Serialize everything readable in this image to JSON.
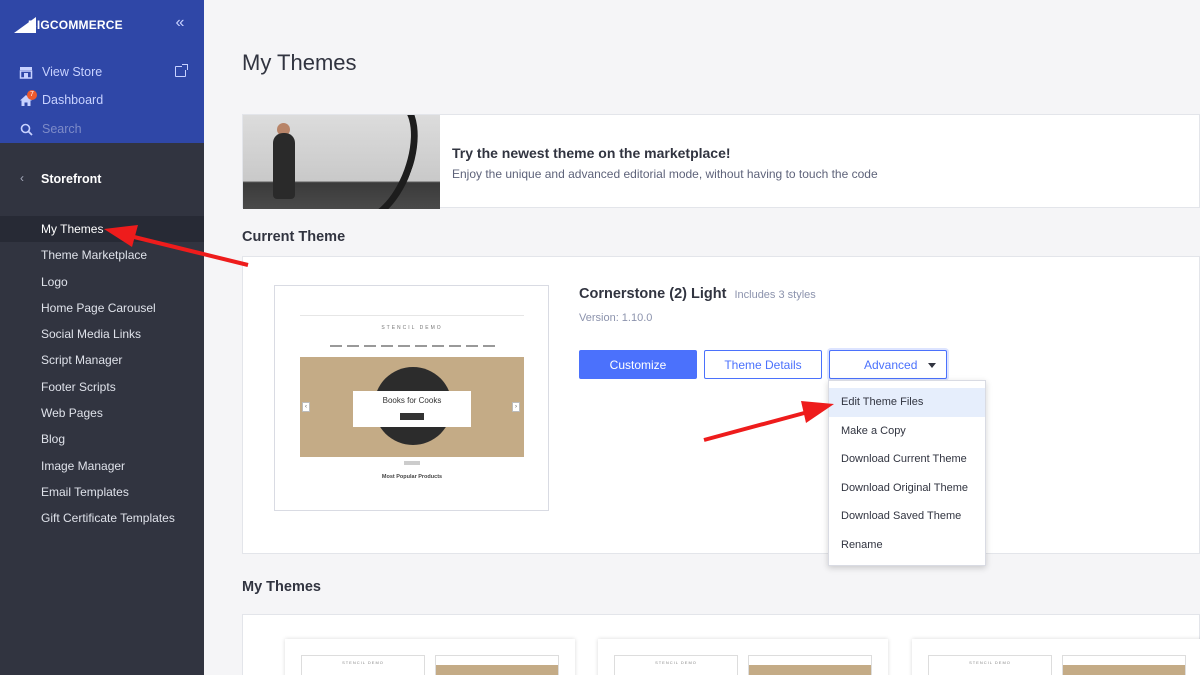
{
  "brand": {
    "logo_text": "BIGCOMMERCE"
  },
  "sidebar": {
    "top_links": [
      {
        "label": "View Store",
        "icon": "store-icon"
      },
      {
        "label": "Dashboard",
        "icon": "home-icon",
        "badge": "7"
      },
      {
        "label": "Search",
        "icon": "search-icon"
      }
    ],
    "section": "Storefront",
    "items": [
      {
        "label": "My Themes",
        "active": true
      },
      {
        "label": "Theme Marketplace"
      },
      {
        "label": "Logo"
      },
      {
        "label": "Home Page Carousel"
      },
      {
        "label": "Social Media Links"
      },
      {
        "label": "Script Manager"
      },
      {
        "label": "Footer Scripts"
      },
      {
        "label": "Web Pages"
      },
      {
        "label": "Blog"
      },
      {
        "label": "Image Manager"
      },
      {
        "label": "Email Templates"
      },
      {
        "label": "Gift Certificate Templates"
      }
    ]
  },
  "main": {
    "page_title": "My Themes",
    "promo": {
      "title": "Try the newest theme on the marketplace!",
      "subtitle": "Enjoy the unique and advanced editorial mode, without having to touch the code"
    },
    "current_theme": {
      "section_title": "Current Theme",
      "name": "Cornerstone (2) Light",
      "styles": "Includes 3 styles",
      "version": "Version: 1.10.0",
      "preview": {
        "store_name": "STENCIL DEMO",
        "hero_title": "Books for Cooks",
        "popular_label": "Most Popular Products"
      },
      "buttons": {
        "customize": "Customize",
        "details": "Theme Details",
        "advanced": "Advanced"
      }
    },
    "advanced_menu": [
      {
        "label": "Edit Theme Files",
        "highlighted": true
      },
      {
        "label": "Make a Copy"
      },
      {
        "label": "Download Current Theme"
      },
      {
        "label": "Download Original Theme"
      },
      {
        "label": "Download Saved Theme"
      },
      {
        "label": "Rename"
      }
    ],
    "my_themes": {
      "section_title": "My Themes",
      "preview_store_name": "STENCIL DEMO"
    }
  },
  "colors": {
    "sidebar_top": "#2f47a7",
    "sidebar": "#313440",
    "accent": "#4b71fc",
    "annotation_arrow": "#ee1c1c"
  }
}
